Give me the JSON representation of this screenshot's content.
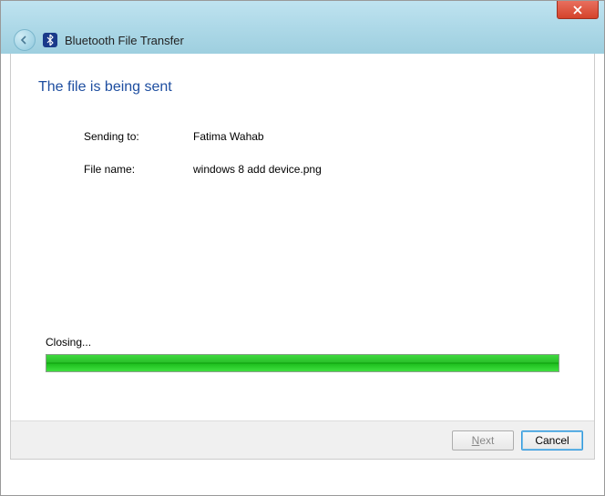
{
  "titlebar": {
    "close_tooltip": "Close"
  },
  "header": {
    "title": "Bluetooth File Transfer"
  },
  "main": {
    "heading": "The file is being sent",
    "sending_to_label": "Sending to:",
    "sending_to_value": "Fatima Wahab",
    "filename_label": "File name:",
    "filename_value": "windows 8 add device.png",
    "progress_label": "Closing...",
    "progress_percent": 100
  },
  "footer": {
    "next_label_prefix": "N",
    "next_label_rest": "ext",
    "cancel_label": "Cancel"
  }
}
